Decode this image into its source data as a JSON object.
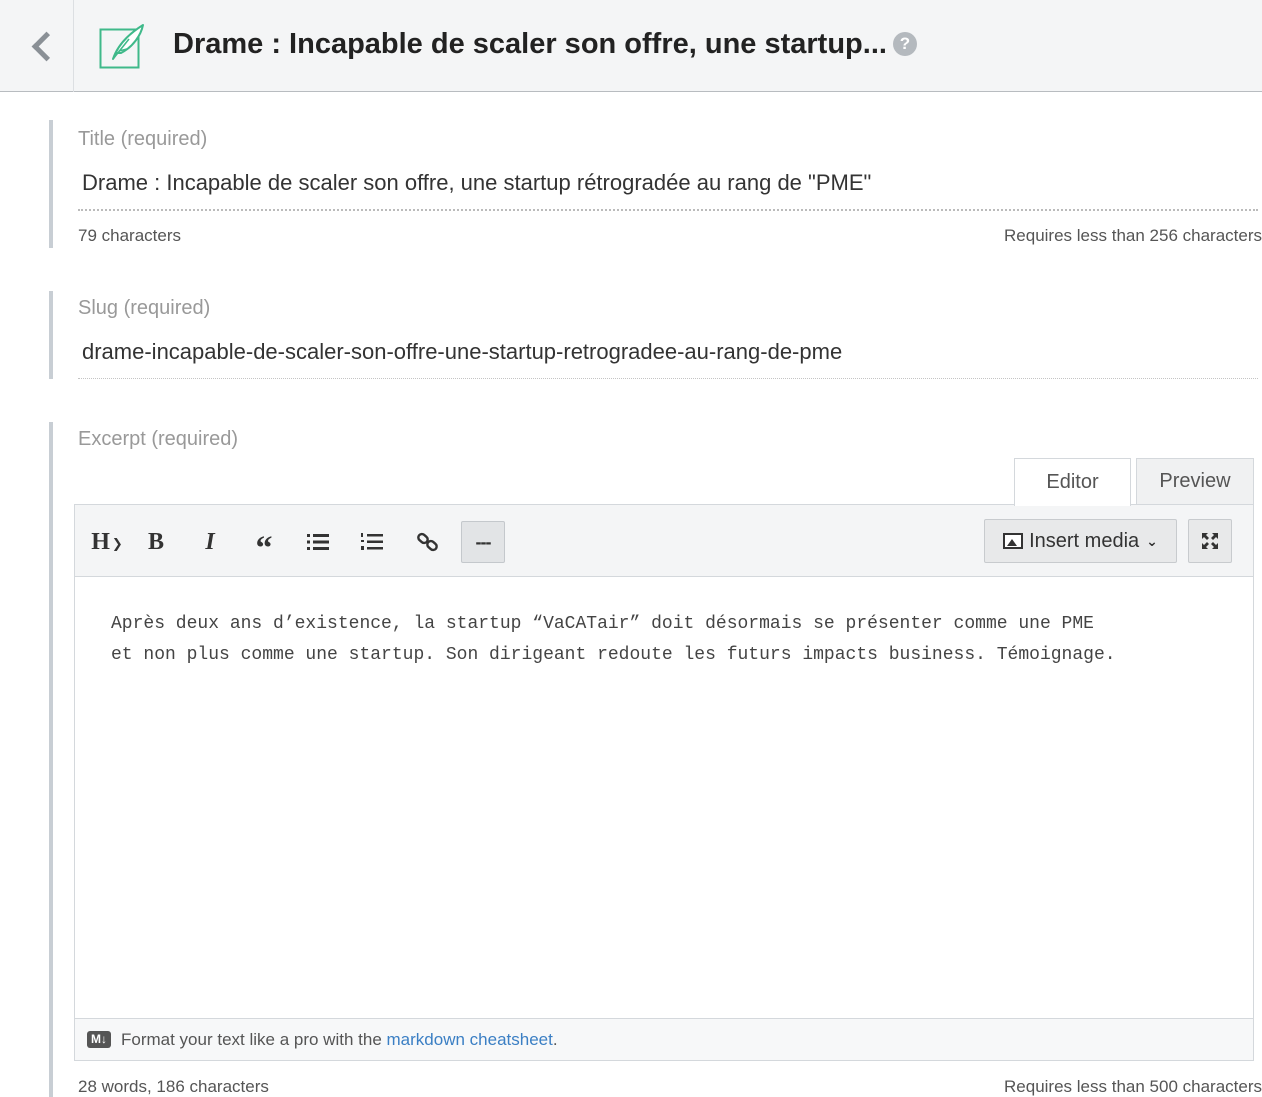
{
  "header": {
    "title": "Drame : Incapable de scaler son offre, une startup...",
    "help": "?"
  },
  "title_field": {
    "label": "Title (required)",
    "value": "Drame : Incapable de scaler son offre, une startup rétrogradée au rang de \"PME\"",
    "count": "79 characters",
    "limit": "Requires less than 256 characters"
  },
  "slug_field": {
    "label": "Slug (required)",
    "value": "drame-incapable-de-scaler-son-offre-une-startup-retrogradee-au-rang-de-pme"
  },
  "excerpt_field": {
    "label": "Excerpt (required)",
    "tabs": {
      "editor": "Editor",
      "preview": "Preview",
      "active": "Editor"
    },
    "toolbar": {
      "heading": "H",
      "bold": "B",
      "italic": "I",
      "quote": "“",
      "hr": "---",
      "insert_media": "Insert media"
    },
    "content": "Après deux ans d’existence, la startup “VaCATair” doit désormais se présenter comme une PME\net non plus comme une startup. Son dirigeant redoute les futurs impacts business. Témoignage.",
    "footer": {
      "badge": "M↓",
      "text": "Format your text like a pro with the",
      "link": "markdown cheatsheet",
      "period": "."
    },
    "count": "28 words, 186 characters",
    "limit": "Requires less than 500 characters"
  },
  "colors": {
    "accent_icon": "#3fb98a",
    "link": "#3b7fc4",
    "section_bar": "#c8ced4"
  }
}
